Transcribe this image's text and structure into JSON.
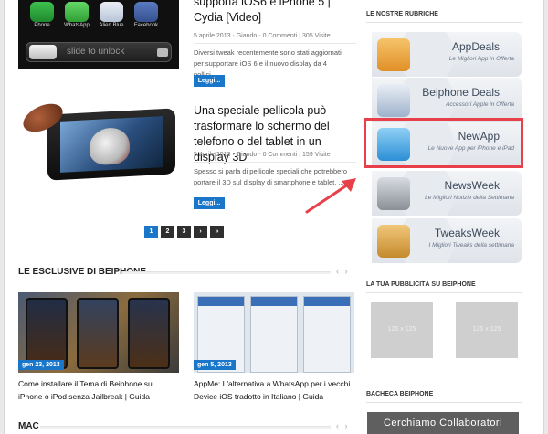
{
  "post_top": {
    "title_tail": "supporta iOS6 e iPhone 5 | Cydia [Video]",
    "meta": {
      "date": "5 aprile 2013",
      "author": "Giando",
      "comments": "0 Commenti",
      "views": "305 Visite"
    },
    "excerpt": "Diversi tweak recentemente sono stati aggiornati per supportare iOS 6 e il nuovo display da 4 pollici...",
    "read_more": "Leggi...",
    "thumb_icons": [
      "Phone",
      "WhatsApp",
      "Alien Blue",
      "Facebook"
    ],
    "slide_text": "slide to unlock"
  },
  "post_second": {
    "title": "Una speciale pellicola può trasformare lo schermo del telefono o del tablet in un display 3D",
    "meta": {
      "date": "5 aprile 2013",
      "author": "Giando",
      "comments": "0 Commenti",
      "views": "159 Visite"
    },
    "excerpt": "Spesso si parla di pellicole speciali che potrebbero portare il 3D sul display di smartphone e tablet. ...",
    "read_more": "Leggi..."
  },
  "pagination": {
    "pages": [
      "1",
      "2",
      "3"
    ],
    "next": "›",
    "last": "»",
    "active": "1"
  },
  "exclusives": {
    "heading": "LE ESCLUSIVE DI BEIPHONE",
    "items": [
      {
        "date": "gen 23, 2013",
        "title_line1": "Come installare il Tema di Beiphone su",
        "title_line2": "iPhone o iPod senza Jailbreak | Guida"
      },
      {
        "date": "gen 5, 2013",
        "title_line1": "AppMe: L'alternativa a WhatsApp per i vecchi",
        "title_line2": "Device iOS tradotto in Italiano | Guida"
      }
    ]
  },
  "mac": {
    "heading": "MAC"
  },
  "sidebar": {
    "rubriche_title": "LE NOSTRE RUBRICHE",
    "rubriche": [
      {
        "name": "AppDeals",
        "tagline": "Le Migliori App in Offerta",
        "color": "#e8a33a"
      },
      {
        "name": "Beiphone Deals",
        "tagline": "Accessori Apple in Offerta",
        "color": "#3f6ea8"
      },
      {
        "name": "NewApp",
        "tagline": "Le Nuove App per iPhone e iPad",
        "color": "#2c8fd6"
      },
      {
        "name": "NewsWeek",
        "tagline": "Le Migliori Notizie della Settimana",
        "color": "#8a8f96"
      },
      {
        "name": "TweaksWeek",
        "tagline": "I Migliori Tweaks della settimana",
        "color": "#c58a2c"
      }
    ],
    "ads_title": "LA TUA PUBBLICITÀ SU BEIPHONE",
    "ads": [
      "125 x 125",
      "125 x 125"
    ],
    "bacheca_title": "BACHECA BEIPHONE",
    "collab_text": "Cerchiamo Collaboratori"
  },
  "colors": {
    "accent": "#1a76c9",
    "highlight": "#e8404a"
  }
}
